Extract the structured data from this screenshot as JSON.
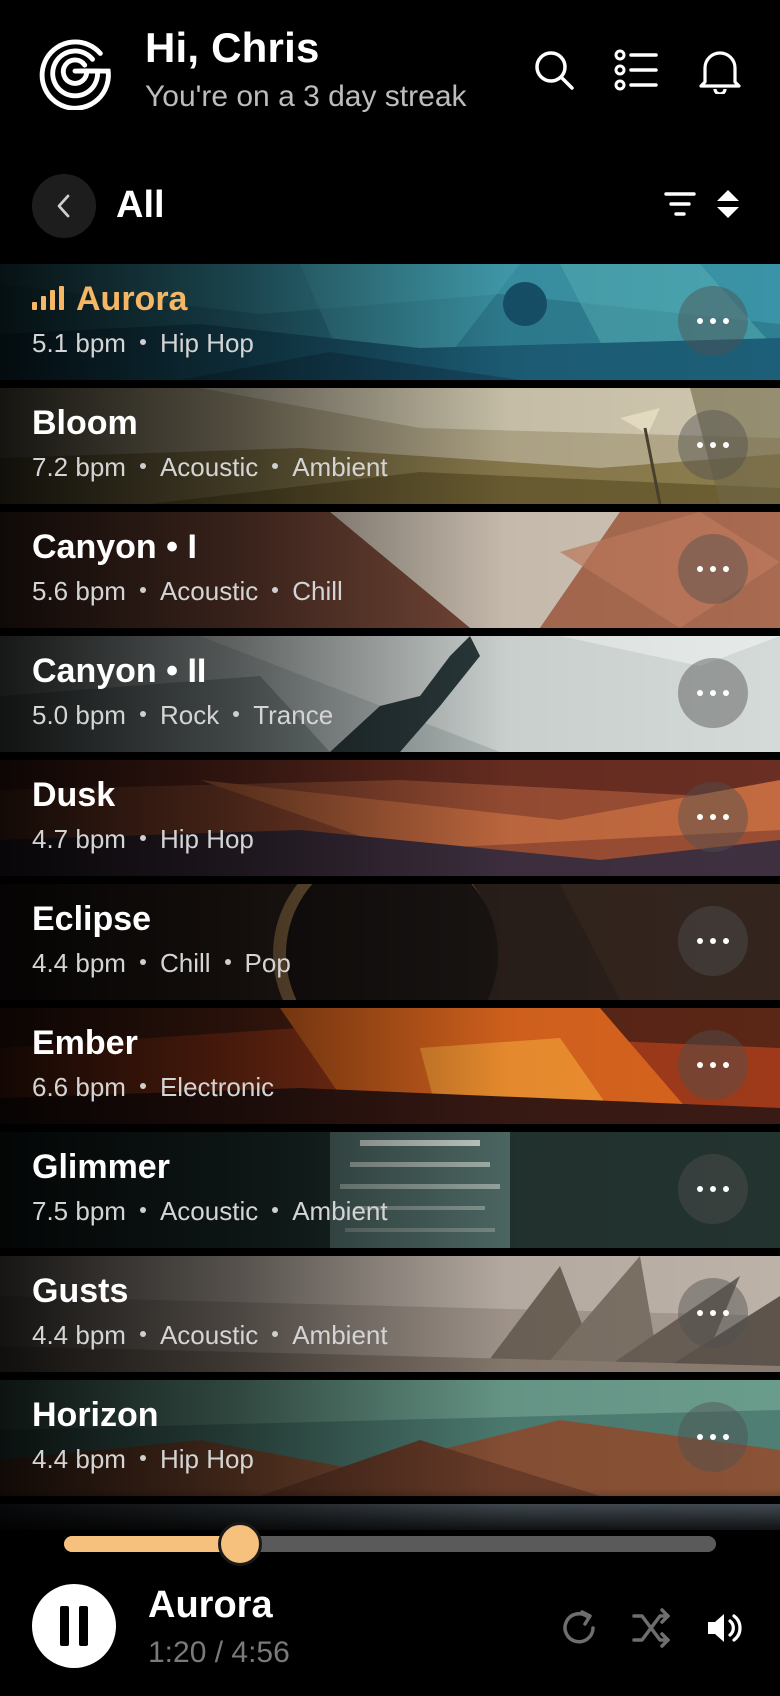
{
  "header": {
    "greeting": "Hi, Chris",
    "streak": "You're on a 3 day streak"
  },
  "subheader": {
    "title": "All"
  },
  "tracks": [
    {
      "title": "Aurora",
      "bpm": "5.1 bpm",
      "tags": [
        "Hip Hop"
      ],
      "playing": true
    },
    {
      "title": "Bloom",
      "bpm": "7.2 bpm",
      "tags": [
        "Acoustic",
        "Ambient"
      ]
    },
    {
      "title": "Canyon • I",
      "bpm": "5.6 bpm",
      "tags": [
        "Acoustic",
        "Chill"
      ]
    },
    {
      "title": "Canyon • II",
      "bpm": "5.0 bpm",
      "tags": [
        "Rock",
        "Trance"
      ]
    },
    {
      "title": "Dusk",
      "bpm": "4.7 bpm",
      "tags": [
        "Hip Hop"
      ]
    },
    {
      "title": "Eclipse",
      "bpm": "4.4 bpm",
      "tags": [
        "Chill",
        "Pop"
      ]
    },
    {
      "title": "Ember",
      "bpm": "6.6 bpm",
      "tags": [
        "Electronic"
      ]
    },
    {
      "title": "Glimmer",
      "bpm": "7.5 bpm",
      "tags": [
        "Acoustic",
        "Ambient"
      ]
    },
    {
      "title": "Gusts",
      "bpm": "4.4 bpm",
      "tags": [
        "Acoustic",
        "Ambient"
      ]
    },
    {
      "title": "Horizon",
      "bpm": "4.4 bpm",
      "tags": [
        "Hip Hop"
      ]
    }
  ],
  "player": {
    "title": "Aurora",
    "time": "1:20 / 4:56",
    "progress": 0.27
  },
  "colors": {
    "accent": "#f5b765",
    "background": "#000000"
  },
  "icons": {
    "logo": "swirl-logo-icon",
    "search": "search-icon",
    "list": "list-icon",
    "notifications": "bell-icon",
    "back": "chevron-left-icon",
    "filter": "filter-icon",
    "sort": "sort-icon",
    "more": "more-icon",
    "pause": "pause-icon",
    "repeat": "repeat-icon",
    "shuffle": "shuffle-icon",
    "volume": "volume-icon"
  }
}
